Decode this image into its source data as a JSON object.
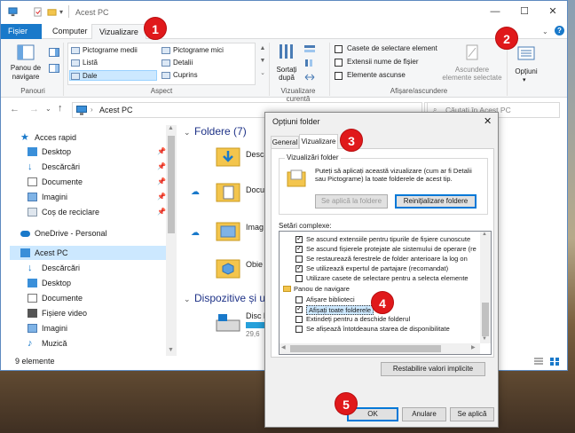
{
  "window": {
    "title": "Acest PC",
    "tabs": {
      "file": "Fișier",
      "computer": "Computer",
      "view": "Vizualizare"
    }
  },
  "ribbon": {
    "panes": {
      "nav_pane": "Panou de navigare",
      "group": "Panouri"
    },
    "layout": {
      "items": [
        "Pictograme medii",
        "Pictograme mici",
        "Listă",
        "Detalii",
        "Dale",
        "Cuprins"
      ],
      "group": "Aspect"
    },
    "current_view": {
      "sort": "Sortați după",
      "group": "Vizualizare curentă"
    },
    "show_hide": {
      "checkboxes": [
        {
          "label": "Casete de selectare element",
          "checked": false
        },
        {
          "label": "Extensii nume de fișier",
          "checked": false
        },
        {
          "label": "Elemente ascunse",
          "checked": false
        }
      ],
      "hide_selected": "Ascundere elemente selectate",
      "group": "Afișare/ascundere"
    },
    "options": "Opțiuni"
  },
  "address": {
    "path": "Acest PC",
    "search_placeholder": "Căutați în Acest PC"
  },
  "nav": {
    "quick_access": "Acces rapid",
    "quick_items": [
      "Desktop",
      "Descărcări",
      "Documente",
      "Imagini",
      "Coș de reciclare"
    ],
    "onedrive": "OneDrive - Personal",
    "this_pc": "Acest PC",
    "pc_items": [
      "Descărcări",
      "Desktop",
      "Documente",
      "Fișiere video",
      "Imagini",
      "Muzică"
    ]
  },
  "content": {
    "folders_header": "Foldere (7)",
    "folders": [
      "Descă",
      "Docu",
      "Imag",
      "Obie"
    ],
    "devices_header": "Dispozitive și uni",
    "disk_name": "Disc l",
    "disk_free": "29,6"
  },
  "status": {
    "count": "9 elemente"
  },
  "dialog": {
    "title": "Opțiuni folder",
    "tabs": {
      "general": "General",
      "view": "Vizualizare"
    },
    "folder_views": {
      "legend": "Vizualizări folder",
      "desc": "Puteți să aplicați această vizualizare (cum ar fi Detalii sau Pictograme) la toate folderele de acest tip.",
      "apply_btn": "Se aplică la foldere",
      "reset_btn": "Reinițializare foldere"
    },
    "advanced_label": "Setări complexe:",
    "advanced_rows": [
      {
        "label": "Se ascund extensiile pentru tipurile de fișiere cunoscute",
        "checked": true,
        "kind": "check"
      },
      {
        "label": "Se ascund fișierele protejate ale sistemului de operare (re",
        "checked": true,
        "kind": "check"
      },
      {
        "label": "Se restaurează ferestrele de folder anterioare la log on",
        "checked": false,
        "kind": "check"
      },
      {
        "label": "Se utilizează expertul de partajare (recomandat)",
        "checked": true,
        "kind": "check"
      },
      {
        "label": "Utilizare casete de selectare pentru a selecta elemente",
        "checked": false,
        "kind": "check"
      },
      {
        "label": "Panou de navigare",
        "checked": false,
        "kind": "folder"
      },
      {
        "label": "Afișare biblioteci",
        "checked": false,
        "kind": "sub"
      },
      {
        "label": "Afișați toate folderele",
        "checked": true,
        "kind": "sub-selected"
      },
      {
        "label": "Extindeți pentru a deschide folderul",
        "checked": false,
        "kind": "sub"
      },
      {
        "label": "Se afișează întotdeauna starea de disponibilitate",
        "checked": false,
        "kind": "sub"
      }
    ],
    "restore_btn": "Restabilire valori implicite",
    "ok": "OK",
    "cancel": "Anulare",
    "apply": "Se aplică"
  },
  "badges": [
    "1",
    "2",
    "3",
    "4",
    "5"
  ],
  "colors": {
    "accent": "#1979ca",
    "badge": "#e0191b",
    "selection": "#cce8ff"
  }
}
